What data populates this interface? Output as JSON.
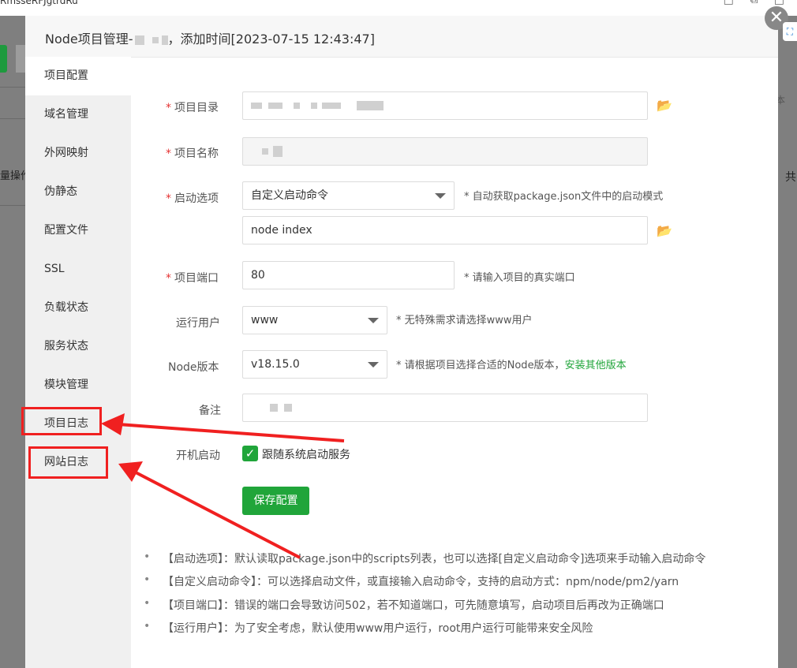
{
  "background": {
    "window_title": "RmsseRFJgtrdRu",
    "window_controls": "□ ⧉ □",
    "left_text": "量操作",
    "right_text": "共",
    "right_text2": "本"
  },
  "modal": {
    "title": "Node项目管理-",
    "title_suffix": "，添加时间[2023-07-15 12:43:47]",
    "close_glyph": "✕",
    "expand_glyph": "⛶"
  },
  "sidebar": {
    "items": [
      {
        "label": "项目配置"
      },
      {
        "label": "域名管理"
      },
      {
        "label": "外网映射"
      },
      {
        "label": "伪静态"
      },
      {
        "label": "配置文件"
      },
      {
        "label": "SSL"
      },
      {
        "label": "负载状态"
      },
      {
        "label": "服务状态"
      },
      {
        "label": "模块管理"
      },
      {
        "label": "项目日志"
      },
      {
        "label": "网站日志"
      }
    ]
  },
  "form": {
    "project_dir": {
      "label": "项目目录",
      "icon": "folder-icon"
    },
    "project_name": {
      "label": "项目名称"
    },
    "start_option": {
      "label": "启动选项",
      "value": "自定义启动命令",
      "hint": "* 自动获取package.json文件中的启动模式"
    },
    "start_command": {
      "value": "node index",
      "icon": "folder-icon"
    },
    "port": {
      "label": "项目端口",
      "value": "80",
      "hint": "* 请输入项目的真实端口"
    },
    "run_user": {
      "label": "运行用户",
      "value": "www",
      "hint": "* 无特殊需求请选择www用户"
    },
    "node_version": {
      "label": "Node版本",
      "value": "v18.15.0",
      "hint": "* 请根据项目选择合适的Node版本，",
      "hint_link": "安装其他版本"
    },
    "remark": {
      "label": "备注"
    },
    "autostart": {
      "label": "开机启动",
      "checkbox_label": "跟随系统启动服务",
      "checked": true
    },
    "save_label": "保存配置",
    "required_mark": "*"
  },
  "notes": [
    "【启动选项】：默认读取package.json中的scripts列表，也可以选择[自定义启动命令]选项来手动输入启动命令",
    "【自定义启动命令】：可以选择启动文件，或直接输入启动命令，支持的启动方式：npm/node/pm2/yarn",
    "【项目端口】：错误的端口会导致访问502，若不知道端口，可先随意填写，启动项目后再改为正确端口",
    "【运行用户】：为了安全考虑，默认使用www用户运行，root用户运行可能带来安全风险"
  ],
  "colors": {
    "accent": "#20a53a",
    "annotation": "#f02020",
    "required": "#e53333"
  }
}
